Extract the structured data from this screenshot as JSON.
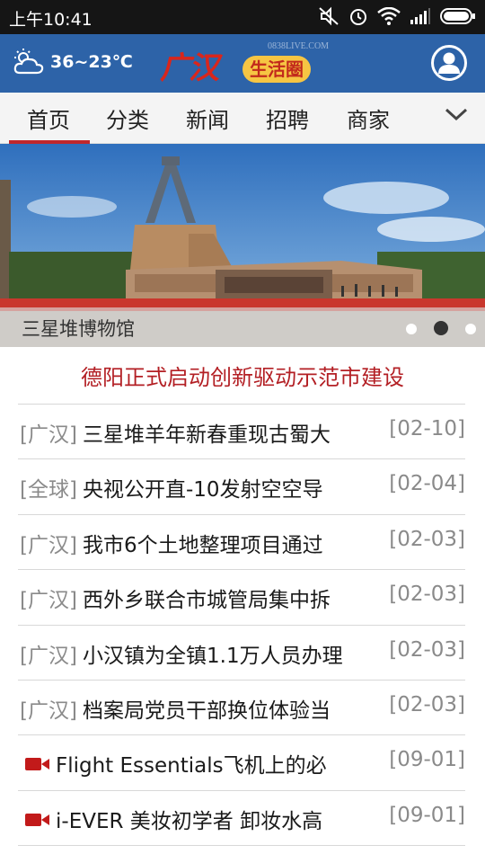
{
  "status_bar": {
    "time": "上午10:41",
    "icons": [
      "mute-icon",
      "alarm-icon",
      "wifi-icon",
      "signal-icon",
      "battery-icon"
    ]
  },
  "header": {
    "temperature": "36~23℃",
    "weather_icon": "partly-cloudy-icon",
    "logo_text": "广汉",
    "logo_badge": "生活圈",
    "logo_url": "0838LIVE.COM",
    "user_icon": "user-icon",
    "bg_color": "#2d63a8"
  },
  "nav": {
    "tabs": [
      "首页",
      "分类",
      "新闻",
      "招聘",
      "商家"
    ],
    "active_index": 0,
    "active_color": "#c0272d",
    "more_icon": "chevron-down-icon"
  },
  "banner": {
    "caption": "三星堆博物馆",
    "dots": 3,
    "active_dot": 1
  },
  "headline": "德阳正式启动创新驱动示范市建设",
  "news": [
    {
      "tag": "[广汉]",
      "title": "三星堆羊年新春重现古蜀大",
      "date": "[02-10]"
    },
    {
      "tag": "[全球]",
      "title": "央视公开直-10发射空空导",
      "date": "[02-04]"
    },
    {
      "tag": "[广汉]",
      "title": "我市6个土地整理项目通过",
      "date": "[02-03]"
    },
    {
      "tag": "[广汉]",
      "title": "西外乡联合市城管局集中拆",
      "date": "[02-03]"
    },
    {
      "tag": "[广汉]",
      "title": "小汉镇为全镇1.1万人员办理",
      "date": "[02-03]"
    },
    {
      "tag": "[广汉]",
      "title": "档案局党员干部换位体验当",
      "date": "[02-03]"
    }
  ],
  "videos": [
    {
      "title": "Flight Essentials飞机上的必",
      "date": "[09-01]",
      "icon": "video-camera-icon"
    },
    {
      "title": "i-EVER 美妆初学者 卸妆水高",
      "date": "[09-01]",
      "icon": "video-camera-icon"
    }
  ]
}
